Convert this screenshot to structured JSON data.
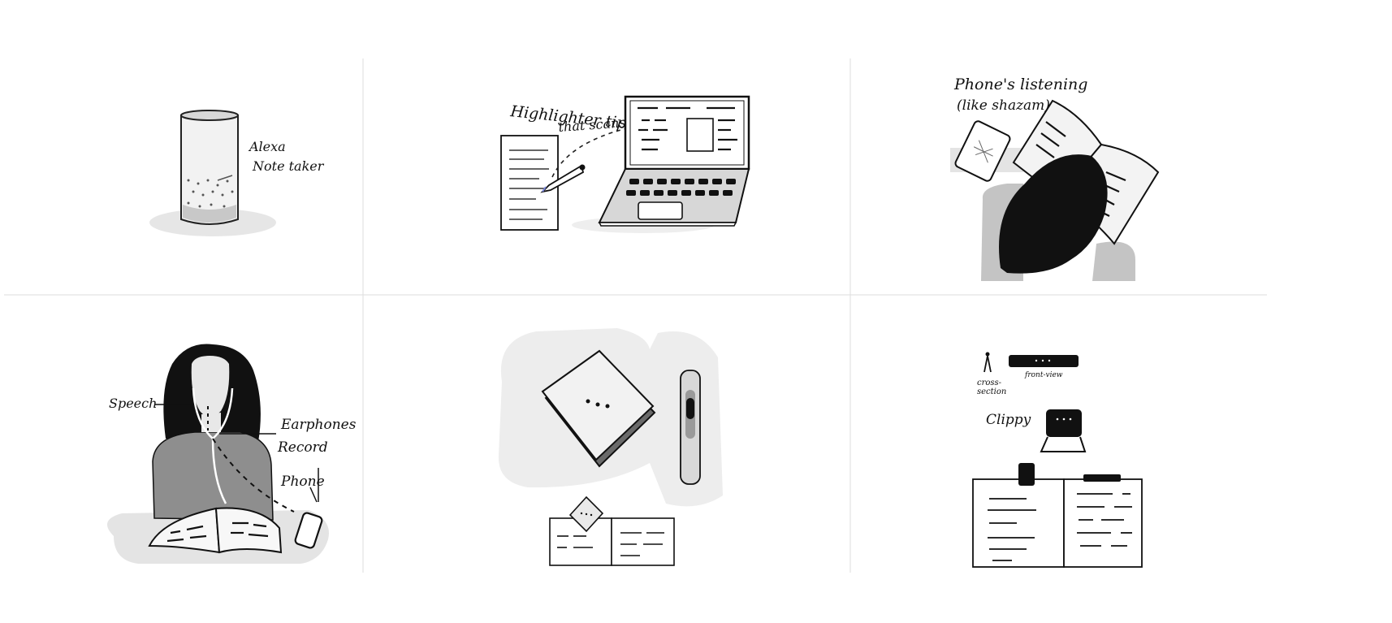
{
  "panels": {
    "alexa": {
      "label_line1": "Alexa",
      "label_line2": "Note taker"
    },
    "laptop": {
      "label_line1": "Highlighter tip",
      "label_line2": "that scans"
    },
    "phone_listening": {
      "label_line1": "Phone's listening",
      "label_line2": "(like shazam)"
    },
    "earphones": {
      "label_speech": "Speech",
      "label_earphones_line1": "Earphones",
      "label_earphones_line2": "Record",
      "label_phone": "Phone"
    },
    "device": {},
    "clippy": {
      "label_cross_line1": "cross-",
      "label_cross_line2": "section",
      "label_front": "front-view",
      "label_clippy": "Clippy"
    }
  },
  "colors": {
    "ink": "#111111",
    "shade_light": "#e6e6e6",
    "shade_mid": "#bdbdbd",
    "shade_dark": "#8a8a8a",
    "grid": "#dddddd"
  }
}
